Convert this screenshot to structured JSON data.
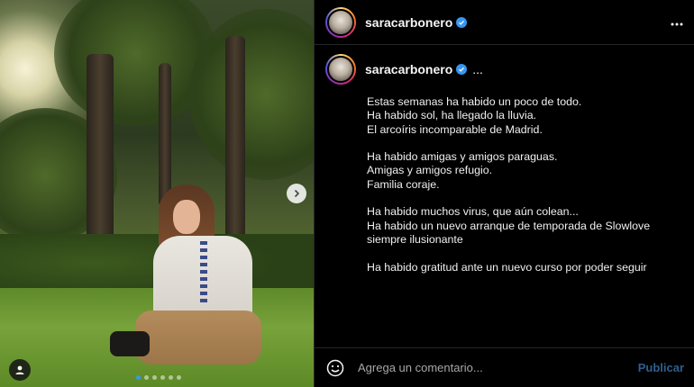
{
  "post": {
    "username": "saracarbonero",
    "carousel": {
      "slide_count": 6,
      "active_index": 0
    }
  },
  "caption": {
    "username": "saracarbonero",
    "ellipsis": "...",
    "paragraphs": [
      [
        "Estas semanas ha habido un poco de todo.",
        "Ha habido sol, ha llegado la lluvia.",
        "El arcoíris incomparable de Madrid."
      ],
      [
        "Ha habido amigas y amigos paraguas.",
        "Amigas y amigos refugio.",
        "Familia coraje."
      ],
      [
        "Ha habido muchos virus, que aún colean...",
        "Ha habido un nuevo arranque de temporada de Slowlove",
        "siempre ilusionante"
      ],
      [
        "Ha habido gratitud ante un nuevo curso por poder seguir"
      ]
    ]
  },
  "comment_box": {
    "placeholder": "Agrega un comentario...",
    "publish_label": "Publicar"
  },
  "icons": {
    "verified": "verified-badge-icon",
    "more": "more-options-icon",
    "emoji": "emoji-icon",
    "next": "chevron-right-icon",
    "tag": "user-tag-icon"
  },
  "colors": {
    "accent": "#3897f0",
    "publish": "#2f5f8f",
    "background": "#000000"
  }
}
